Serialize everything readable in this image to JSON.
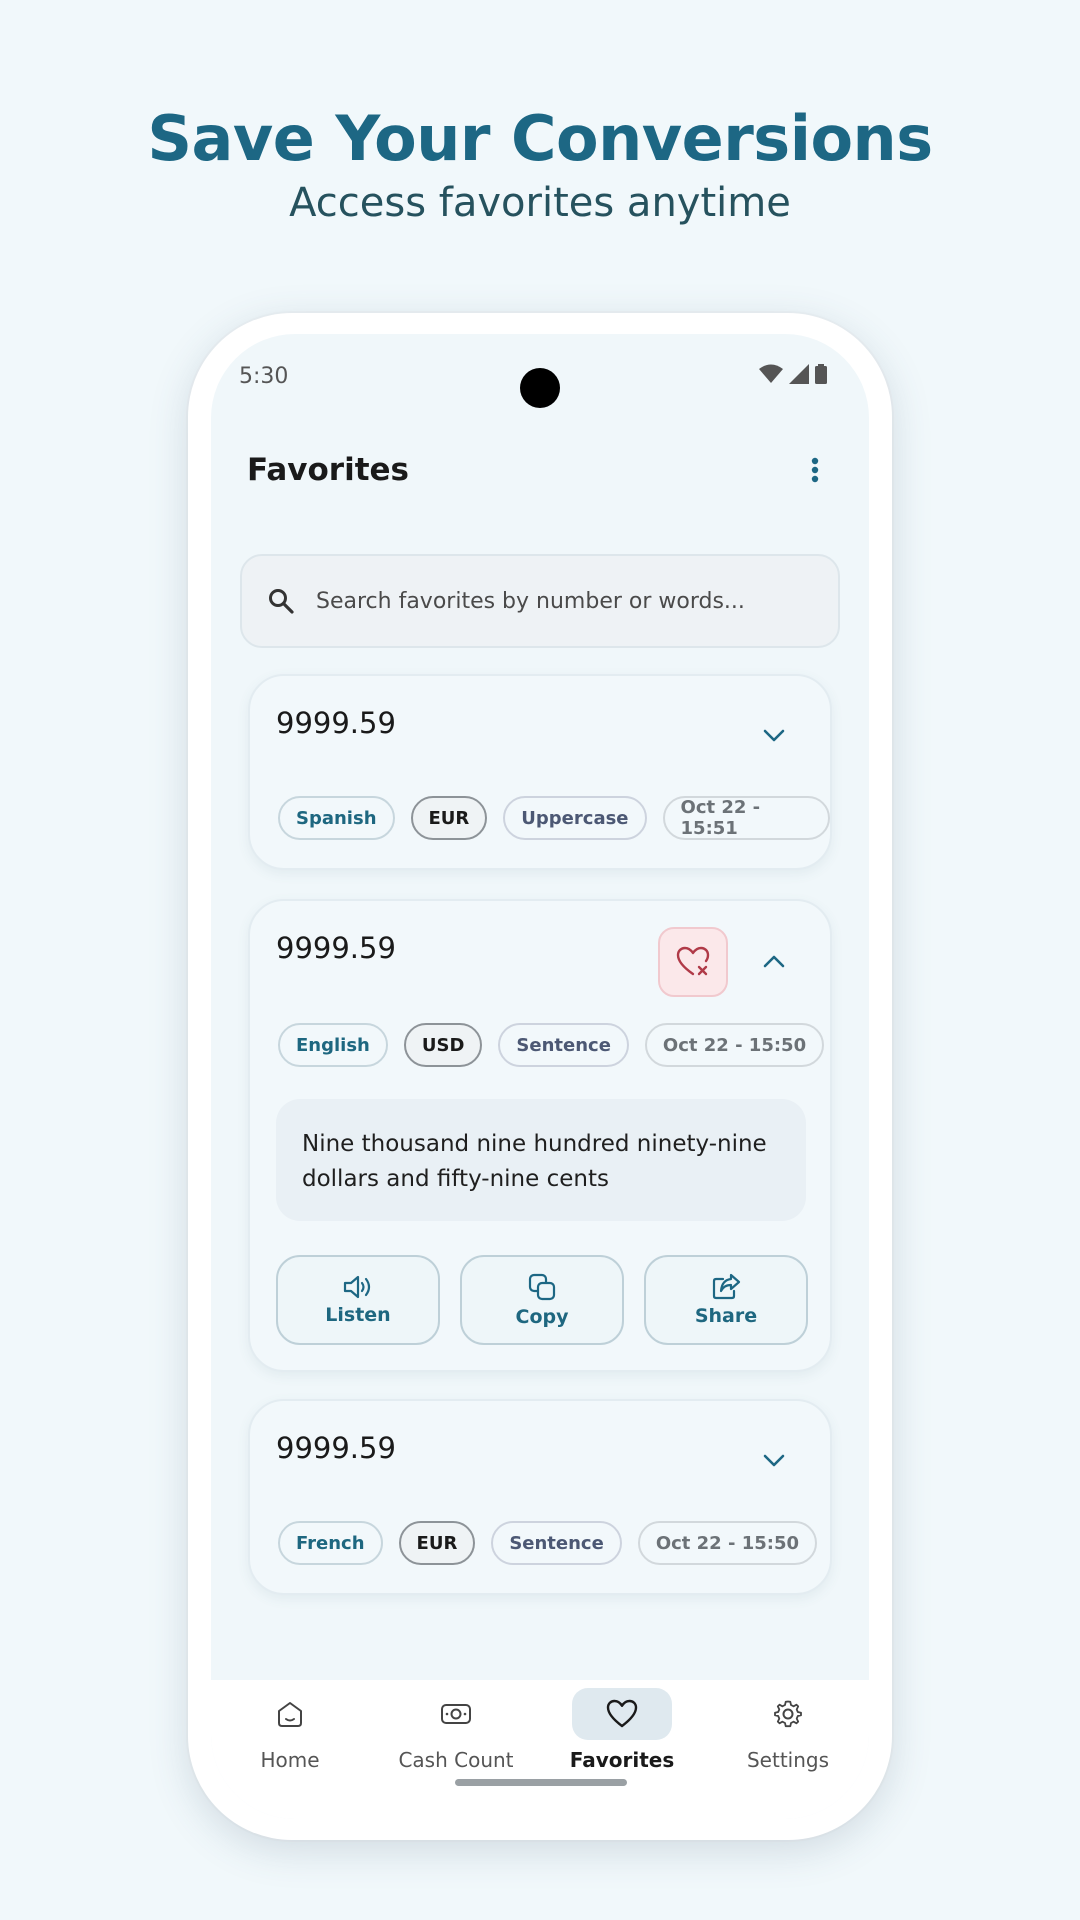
{
  "promo": {
    "headline": "Save Your Conversions",
    "subheadline": "Access favorites anytime"
  },
  "status_bar": {
    "time": "5:30",
    "icons": [
      "wifi-icon",
      "cellular-signal-icon",
      "battery-icon"
    ]
  },
  "app_bar": {
    "title": "Favorites",
    "menu_icon": "more-vert-icon"
  },
  "search": {
    "icon": "search-icon",
    "placeholder": "Search favorites by number or words..."
  },
  "favorites": [
    {
      "number": "9999.59",
      "expanded": false,
      "chips": {
        "language": "Spanish",
        "currency": "EUR",
        "case": "Uppercase",
        "date": "Oct 22 - 15:51"
      }
    },
    {
      "number": "9999.59",
      "expanded": true,
      "chips": {
        "language": "English",
        "currency": "USD",
        "case": "Sentence",
        "date": "Oct 22 - 15:50"
      },
      "words": "Nine thousand nine hundred ninety-nine dollars and fifty-nine cents",
      "actions": {
        "listen": "Listen",
        "copy": "Copy",
        "share": "Share"
      }
    },
    {
      "number": "9999.59",
      "expanded": false,
      "chips": {
        "language": "French",
        "currency": "EUR",
        "case": "Sentence",
        "date": "Oct 22 - 15:50"
      }
    }
  ],
  "bottom_nav": {
    "items": [
      {
        "label": "Home",
        "icon": "home-icon",
        "active": false
      },
      {
        "label": "Cash Count",
        "icon": "cash-icon",
        "active": false
      },
      {
        "label": "Favorites",
        "icon": "heart-icon",
        "active": true
      },
      {
        "label": "Settings",
        "icon": "gear-icon",
        "active": false
      }
    ]
  },
  "colors": {
    "accent": "#1d6784",
    "background": "#f1f8fb",
    "remove_favorite": "#c0392b"
  }
}
